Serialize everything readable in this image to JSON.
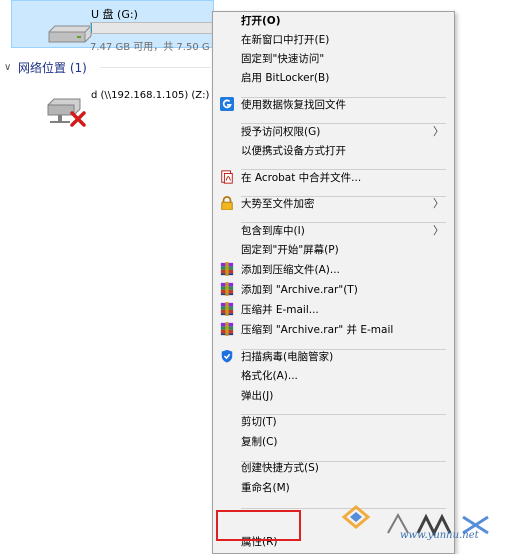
{
  "drive": {
    "name": "U 盘 (G:)",
    "info": "7.47 GB 可用，共 7.50 G",
    "used_fraction": 0.004
  },
  "network_section": {
    "label": "网络位置 (1)"
  },
  "network_drive": {
    "name": "d (\\\\192.168.1.105) (Z:)"
  },
  "context_menu": {
    "items": [
      {
        "label": "打开(O)",
        "bold": true
      },
      {
        "label": "在新窗口中打开(E)"
      },
      {
        "label": "固定到\"快速访问\""
      },
      {
        "label": "启用 BitLocker(B)"
      },
      {
        "label": "使用数据恢复找回文件",
        "icon": "recovery-g-icon"
      },
      {
        "label": "授予访问权限(G)",
        "submenu": true
      },
      {
        "label": "以便携式设备方式打开"
      },
      {
        "label": "在 Acrobat 中合并文件...",
        "icon": "acrobat-icon"
      },
      {
        "label": "大势至文件加密",
        "icon": "lock-icon",
        "submenu": true
      },
      {
        "label": "包含到库中(I)",
        "submenu": true
      },
      {
        "label": "固定到\"开始\"屏幕(P)"
      },
      {
        "label": "添加到压缩文件(A)...",
        "icon": "winrar-icon"
      },
      {
        "label": "添加到 \"Archive.rar\"(T)",
        "icon": "winrar-icon"
      },
      {
        "label": "压缩并 E-mail...",
        "icon": "winrar-icon"
      },
      {
        "label": "压缩到 \"Archive.rar\" 并 E-mail",
        "icon": "winrar-icon"
      },
      {
        "label": "扫描病毒(电脑管家)",
        "icon": "shield-icon"
      },
      {
        "label": "格式化(A)..."
      },
      {
        "label": "弹出(J)"
      },
      {
        "label": "剪切(T)"
      },
      {
        "label": "复制(C)"
      },
      {
        "label": "创建快捷方式(S)"
      },
      {
        "label": "重命名(M)"
      },
      {
        "label": "属性(R)"
      }
    ],
    "submenu_arrow": "〉"
  },
  "colors": {
    "selection_bg": "#cce8ff",
    "highlight_border": "#e02020",
    "section_text": "#1e3287"
  },
  "watermark": {
    "url": "www.yunhu.net"
  }
}
